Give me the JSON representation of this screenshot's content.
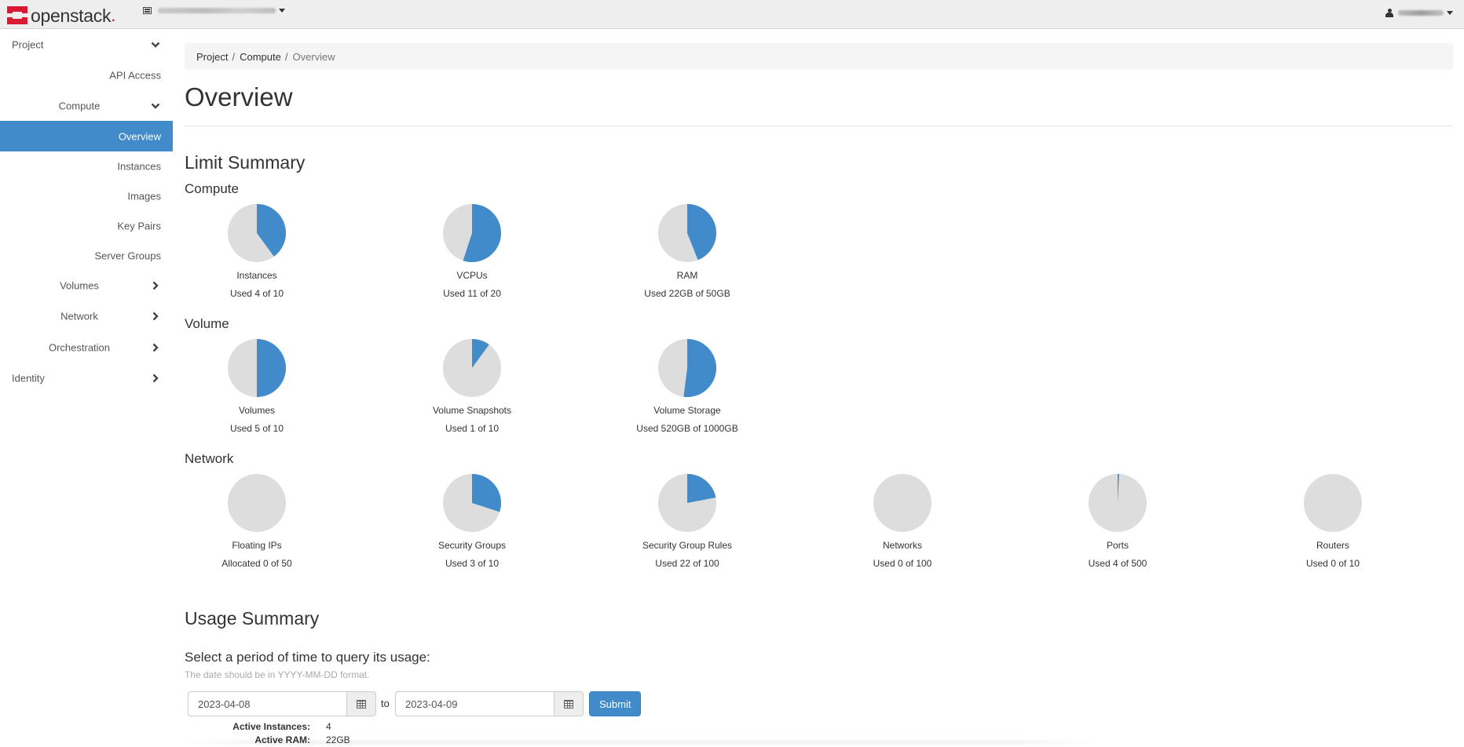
{
  "navbar": {
    "brand": "openstack",
    "brand_dot": ".",
    "colors": {
      "brand_red": "#da1a32"
    }
  },
  "sidebar": {
    "items": [
      {
        "label": "Project",
        "level": 1,
        "icon": "chevron-down-icon"
      },
      {
        "label": "API Access",
        "level": 2
      },
      {
        "label": "Compute",
        "level": 2,
        "icon": "chevron-down-icon"
      },
      {
        "label": "Overview",
        "level": 3,
        "active": true
      },
      {
        "label": "Instances",
        "level": 3
      },
      {
        "label": "Images",
        "level": 3
      },
      {
        "label": "Key Pairs",
        "level": 3
      },
      {
        "label": "Server Groups",
        "level": 3
      },
      {
        "label": "Volumes",
        "level": 2,
        "icon": "chevron-right-icon"
      },
      {
        "label": "Network",
        "level": 2,
        "icon": "chevron-right-icon"
      },
      {
        "label": "Orchestration",
        "level": 2,
        "icon": "chevron-right-icon"
      },
      {
        "label": "Identity",
        "level": 1,
        "icon": "chevron-right-icon"
      }
    ]
  },
  "breadcrumb": {
    "items": [
      "Project",
      "Compute"
    ],
    "separator": "/",
    "current": "Overview"
  },
  "page": {
    "title": "Overview",
    "limit_summary_title": "Limit Summary",
    "usage_summary_title": "Usage Summary"
  },
  "colors": {
    "used": "#428bca",
    "free": "#dddddd",
    "accent": "#428bca"
  },
  "chart_data": [
    {
      "type": "pie",
      "title": "Compute",
      "charts": [
        {
          "label": "Instances",
          "used": 4,
          "total": 10,
          "text": "Used 4 of 10"
        },
        {
          "label": "VCPUs",
          "used": 11,
          "total": 20,
          "text": "Used 11 of 20"
        },
        {
          "label": "RAM",
          "used": 22,
          "total": 50,
          "unit": "GB",
          "text": "Used 22GB of 50GB"
        }
      ]
    },
    {
      "type": "pie",
      "title": "Volume",
      "charts": [
        {
          "label": "Volumes",
          "used": 5,
          "total": 10,
          "text": "Used 5 of 10"
        },
        {
          "label": "Volume Snapshots",
          "used": 1,
          "total": 10,
          "text": "Used 1 of 10"
        },
        {
          "label": "Volume Storage",
          "used": 520,
          "total": 1000,
          "unit": "GB",
          "text": "Used 520GB of 1000GB"
        }
      ]
    },
    {
      "type": "pie",
      "title": "Network",
      "charts": [
        {
          "label": "Floating IPs",
          "used": 0,
          "total": 50,
          "text": "Allocated 0 of 50"
        },
        {
          "label": "Security Groups",
          "used": 3,
          "total": 10,
          "text": "Used 3 of 10"
        },
        {
          "label": "Security Group Rules",
          "used": 22,
          "total": 100,
          "text": "Used 22 of 100"
        },
        {
          "label": "Networks",
          "used": 0,
          "total": 100,
          "text": "Used 0 of 100"
        },
        {
          "label": "Ports",
          "used": 4,
          "total": 500,
          "text": "Used 4 of 500"
        },
        {
          "label": "Routers",
          "used": 0,
          "total": 10,
          "text": "Used 0 of 10"
        }
      ]
    }
  ],
  "usage": {
    "prompt": "Select a period of time to query its usage:",
    "hint": "The date should be in YYYY-MM-DD format.",
    "start_date": "2023-04-08",
    "end_date": "2023-04-09",
    "to_label": "to",
    "submit_label": "Submit",
    "stats": [
      {
        "label": "Active Instances:",
        "value": "4"
      },
      {
        "label": "Active RAM:",
        "value": "22GB"
      }
    ]
  }
}
